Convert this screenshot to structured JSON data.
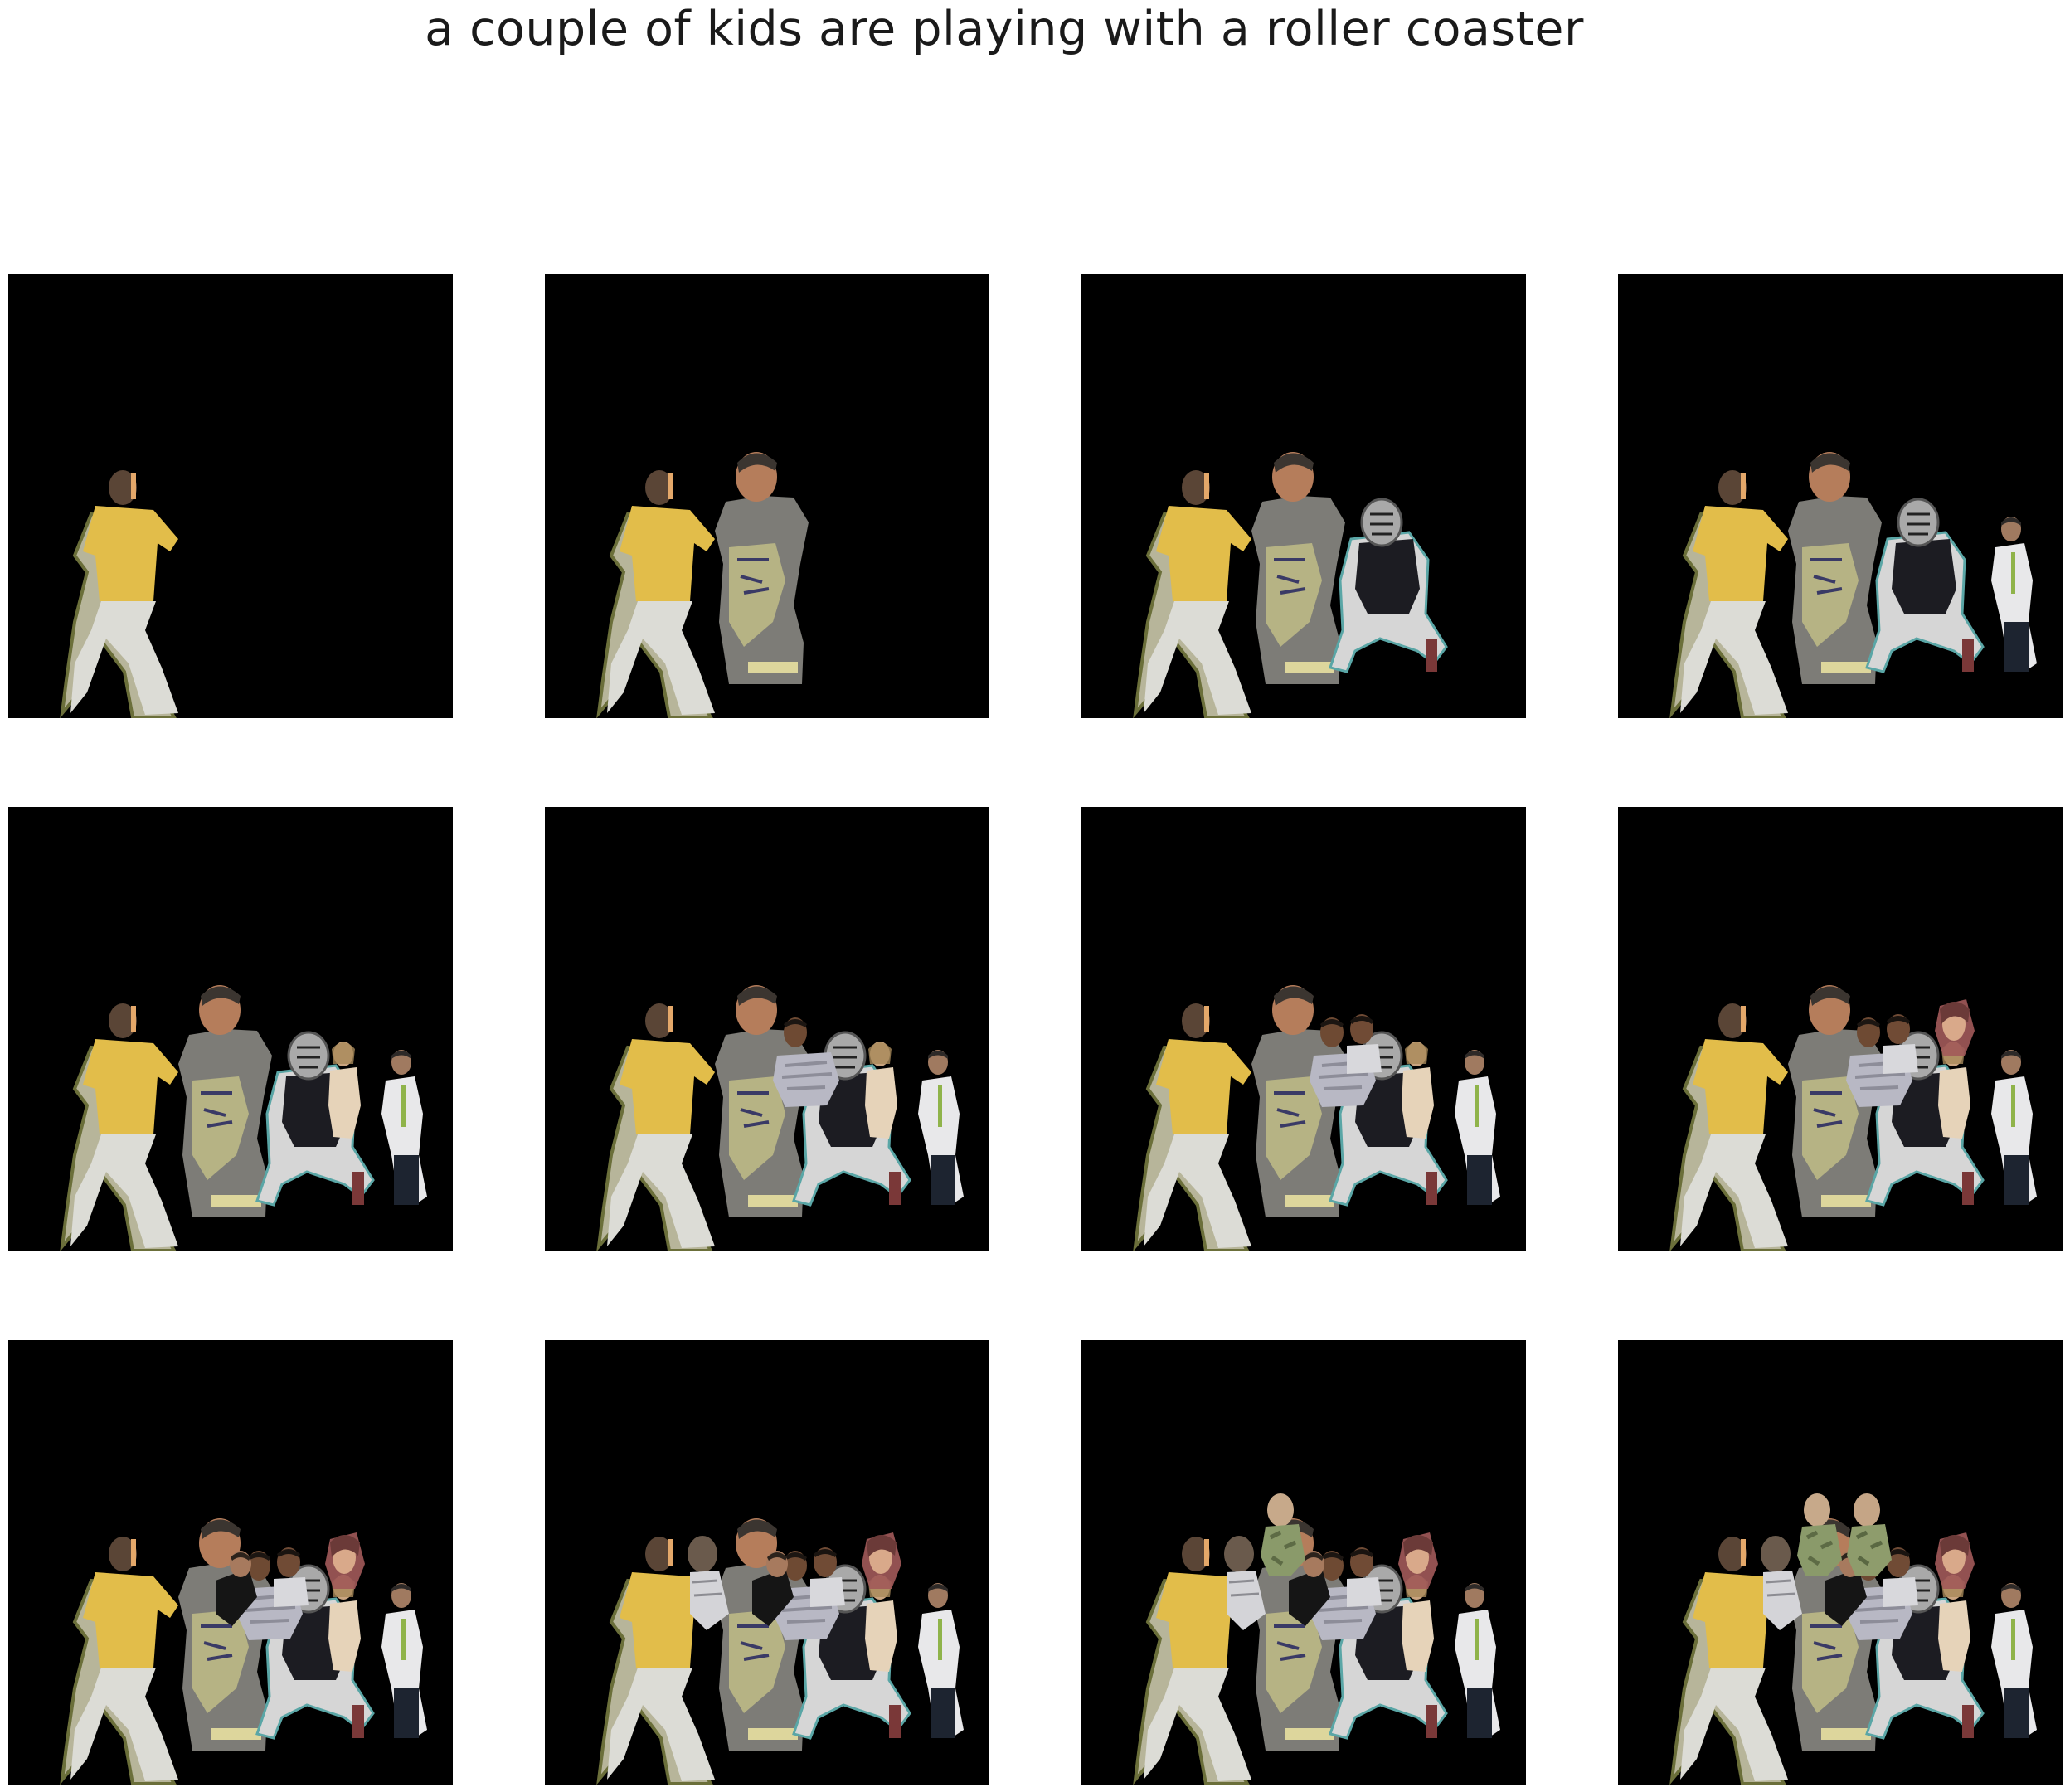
{
  "figure": {
    "title": "a couple of kids are playing with a roller coaster",
    "background": "#000000"
  },
  "panels": [
    {
      "step": 1,
      "objects": [
        "boy-yellow-shirt"
      ]
    },
    {
      "step": 2,
      "objects": [
        "boy-yellow-shirt",
        "man-gray-tshirt"
      ]
    },
    {
      "step": 3,
      "objects": [
        "boy-yellow-shirt",
        "man-gray-tshirt",
        "catcher-gear"
      ]
    },
    {
      "step": 4,
      "objects": [
        "boy-yellow-shirt",
        "man-gray-tshirt",
        "catcher-gear",
        "man-white-shirt"
      ]
    },
    {
      "step": 5,
      "objects": [
        "boy-yellow-shirt",
        "man-gray-tshirt",
        "catcher-gear",
        "man-white-shirt",
        "woman-small"
      ]
    },
    {
      "step": 6,
      "objects": [
        "boy-yellow-shirt",
        "man-gray-tshirt",
        "catcher-gear",
        "man-white-shirt",
        "woman-small",
        "man-mustache"
      ]
    },
    {
      "step": 7,
      "objects": [
        "boy-yellow-shirt",
        "man-gray-tshirt",
        "catcher-gear",
        "man-white-shirt",
        "woman-small",
        "man-mustache",
        "man-mustache-2"
      ]
    },
    {
      "step": 8,
      "objects": [
        "boy-yellow-shirt",
        "man-gray-tshirt",
        "catcher-gear",
        "man-white-shirt",
        "woman-small",
        "man-mustache",
        "man-mustache-2",
        "woman-face"
      ]
    },
    {
      "step": 9,
      "objects": [
        "boy-yellow-shirt",
        "man-gray-tshirt",
        "catcher-gear",
        "man-white-shirt",
        "woman-small",
        "man-mustache",
        "man-mustache-2",
        "woman-face",
        "man-dark-suit"
      ]
    },
    {
      "step": 10,
      "objects": [
        "boy-yellow-shirt",
        "man-gray-tshirt",
        "catcher-gear",
        "man-white-shirt",
        "woman-small",
        "man-mustache",
        "man-mustache-2",
        "woman-face",
        "man-dark-suit",
        "man-back-head"
      ]
    },
    {
      "step": 11,
      "objects": [
        "boy-yellow-shirt",
        "man-gray-tshirt",
        "catcher-gear",
        "man-white-shirt",
        "woman-small",
        "man-mustache",
        "man-mustache-2",
        "woman-face",
        "man-dark-suit",
        "man-back-head",
        "soldier-camo"
      ]
    },
    {
      "step": 12,
      "objects": [
        "boy-yellow-shirt",
        "man-gray-tshirt",
        "catcher-gear",
        "man-white-shirt",
        "woman-small",
        "man-mustache",
        "man-mustache-2",
        "woman-face",
        "man-dark-suit",
        "man-back-head",
        "soldier-camo",
        "soldier-camo-2"
      ]
    }
  ]
}
